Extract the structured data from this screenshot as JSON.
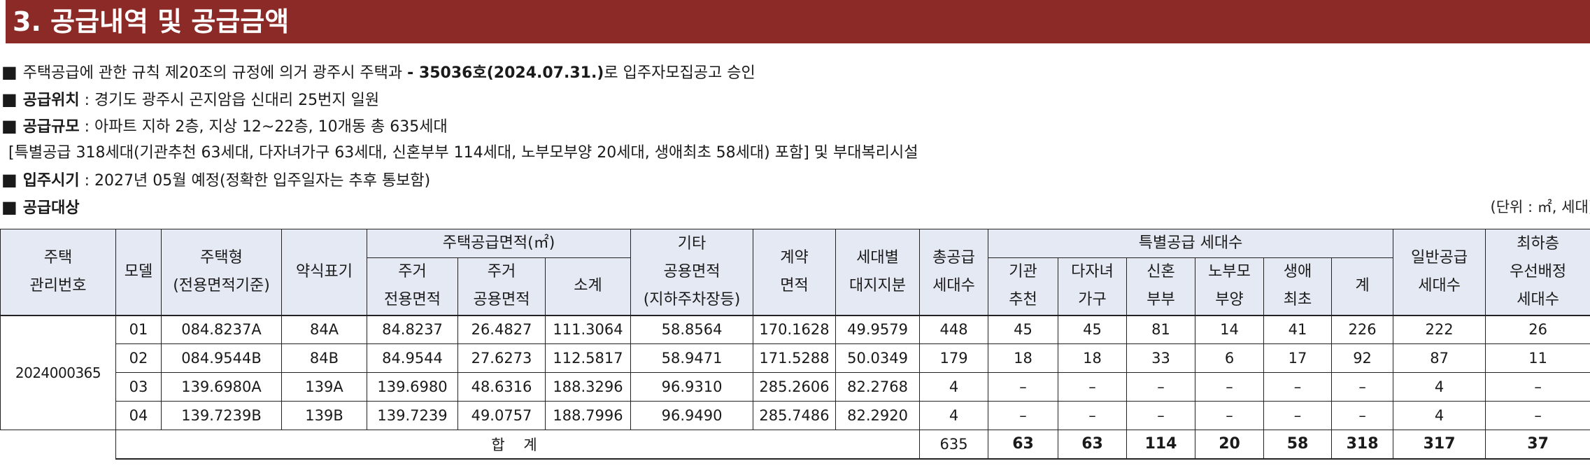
{
  "section": {
    "title": "3. 공급내역 및 공급금액"
  },
  "info": {
    "bullet": "■",
    "line1": {
      "text_a": "주택공급에 관한 규칙 제20조의 규정에 의거 광주시 주택과 ",
      "approval": "- 35036호(2024.07.31.)",
      "text_b": "로 입주자모집공고 승인"
    },
    "location": {
      "label": "공급위치",
      "value": " : 경기도 광주시 곤지암읍 신대리 25번지 일원"
    },
    "scale": {
      "label": "공급규모",
      "value": " : 아파트 지하 2층, 지상 12~22층, 10개동 총 635세대"
    },
    "scale_detail": "[특별공급 318세대(기관추천 63세대, 다자녀가구 63세대, 신혼부부 114세대, 노부모부양 20세대, 생애최초 58세대) 포함] 및 부대복리시설",
    "move_in": {
      "label": "입주시기",
      "value": " : 2027년 05월 예정(정확한 입주일자는 추후 통보함)"
    },
    "target": {
      "label": "공급대상"
    },
    "unit_note": "(단위 : ㎡, 세대)"
  },
  "table": {
    "headers": {
      "mgmt_no": [
        "주택",
        "관리번호"
      ],
      "model": "모델",
      "type": [
        "주택형",
        "(전용면적기준)"
      ],
      "abbr": "약식표기",
      "area_group": "주택공급면적(㎡)",
      "excl": [
        "주거",
        "전용면적"
      ],
      "common": [
        "주거",
        "공용면적"
      ],
      "subtotal": "소계",
      "other": [
        "기타",
        "공용면적",
        "(지하주차장등)"
      ],
      "contract": [
        "계약",
        "면적"
      ],
      "land": [
        "세대별",
        "대지지분"
      ],
      "total_supply": [
        "총공급",
        "세대수"
      ],
      "special_group": "특별공급 세대수",
      "inst": [
        "기관",
        "추천"
      ],
      "multi": [
        "다자녀",
        "가구"
      ],
      "newly": [
        "신혼",
        "부부"
      ],
      "elder": [
        "노부모",
        "부양"
      ],
      "first": [
        "생애",
        "최초"
      ],
      "sp_total": "계",
      "general": [
        "일반공급",
        "세대수"
      ],
      "lowest": [
        "최하층",
        "우선배정",
        "세대수"
      ]
    },
    "mgmt_no": "2024000365",
    "rows": [
      {
        "model": "01",
        "type": "084.8237A",
        "abbr": "84A",
        "excl": "84.8237",
        "common": "26.4827",
        "subtotal": "111.3064",
        "other": "58.8564",
        "contract": "170.1628",
        "land": "49.9579",
        "total": "448",
        "inst": "45",
        "multi": "45",
        "newly": "81",
        "elder": "14",
        "first": "41",
        "sp_total": "226",
        "general": "222",
        "lowest": "26"
      },
      {
        "model": "02",
        "type": "084.9544B",
        "abbr": "84B",
        "excl": "84.9544",
        "common": "27.6273",
        "subtotal": "112.5817",
        "other": "58.9471",
        "contract": "171.5288",
        "land": "50.0349",
        "total": "179",
        "inst": "18",
        "multi": "18",
        "newly": "33",
        "elder": "6",
        "first": "17",
        "sp_total": "92",
        "general": "87",
        "lowest": "11"
      },
      {
        "model": "03",
        "type": "139.6980A",
        "abbr": "139A",
        "excl": "139.6980",
        "common": "48.6316",
        "subtotal": "188.3296",
        "other": "96.9310",
        "contract": "285.2606",
        "land": "82.2768",
        "total": "4",
        "inst": "–",
        "multi": "–",
        "newly": "–",
        "elder": "–",
        "first": "–",
        "sp_total": "–",
        "general": "4",
        "lowest": "–"
      },
      {
        "model": "04",
        "type": "139.7239B",
        "abbr": "139B",
        "excl": "139.7239",
        "common": "49.0757",
        "subtotal": "188.7996",
        "other": "96.9490",
        "contract": "285.7486",
        "land": "82.2920",
        "total": "4",
        "inst": "–",
        "multi": "–",
        "newly": "–",
        "elder": "–",
        "first": "–",
        "sp_total": "–",
        "general": "4",
        "lowest": "–"
      }
    ],
    "total": {
      "label": "합 계",
      "total": "635",
      "inst": "63",
      "multi": "63",
      "newly": "114",
      "elder": "20",
      "first": "58",
      "sp_total": "318",
      "general": "317",
      "lowest": "37"
    }
  }
}
